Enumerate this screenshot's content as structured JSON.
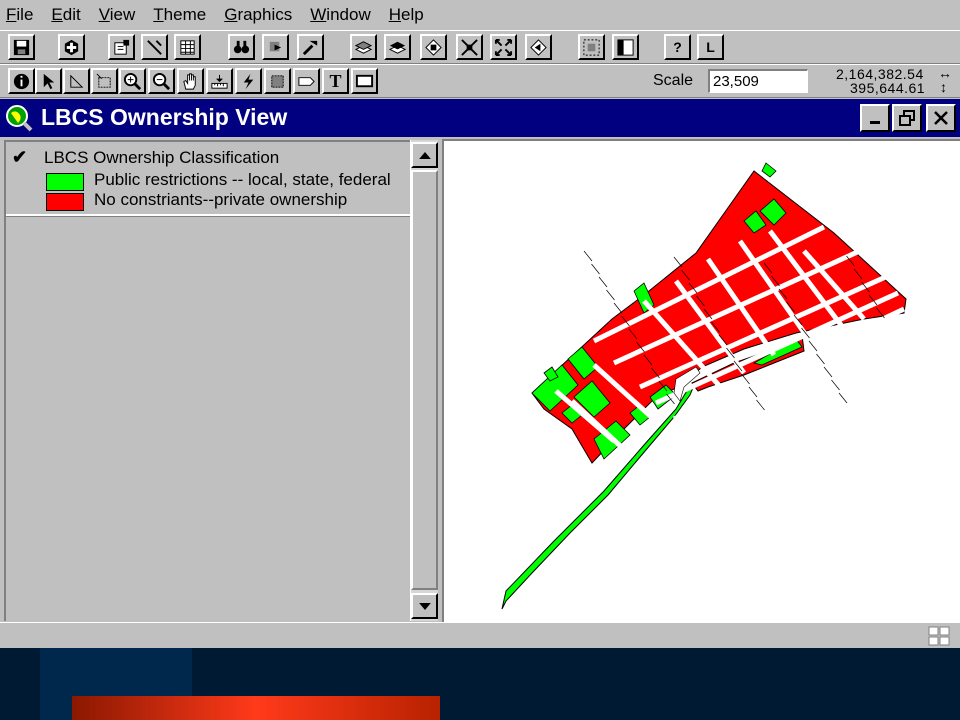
{
  "menu": [
    "File",
    "Edit",
    "View",
    "Theme",
    "Graphics",
    "Window",
    "Help"
  ],
  "toolbar": {
    "button_icons": [
      "save-icon",
      "add-theme-icon",
      "theme-properties-icon",
      "edit-legend-icon",
      "open-table-icon",
      "find-icon",
      "locate-address-icon",
      "query-builder-icon",
      "zoom-to-full-extent-icon",
      "zoom-to-active-themes-icon",
      "zoom-to-selected-icon",
      "zoom-in-icon",
      "zoom-out-icon",
      "zoom-previous-icon",
      "select-by-theme-icon",
      "clear-selection-icon",
      "help-icon",
      "layout-icon"
    ],
    "help_glyph": "?",
    "layout_glyph": "L"
  },
  "tools": {
    "icons": [
      "identify-icon",
      "pointer-icon",
      "vertex-edit-icon",
      "select-feature-icon",
      "zoom-in-tool-icon",
      "zoom-out-tool-icon",
      "pan-tool-icon",
      "measure-tool-icon",
      "hot-link-icon",
      "area-of-interest-icon",
      "label-tool-icon",
      "text-tool-icon",
      "draw-tool-icon"
    ],
    "text_glyph": "T",
    "scale_label": "Scale",
    "scale_value": "23,509",
    "coord_x": "2,164,382.54",
    "coord_y": "395,644.61",
    "coord_x_arrow": "↔",
    "coord_y_arrow": "↕"
  },
  "view": {
    "title": "LBCS Ownership View",
    "window_buttons": [
      "minimize-icon",
      "restore-icon",
      "close-icon"
    ]
  },
  "toc": {
    "theme_checked": true,
    "check_glyph": "✔",
    "theme_name": "LBCS Ownership Classification",
    "legend": [
      {
        "label": "Public restrictions -- local, state, federal",
        "color": "#00ff00"
      },
      {
        "label": "No constriants--private ownership",
        "color": "#ff0000"
      }
    ]
  },
  "map": {
    "public_color": "#00ff00",
    "private_color": "#ff0000",
    "outline_color": "#000000"
  },
  "colors": {
    "title_bar": "#000080",
    "chrome": "#c0c0c0"
  }
}
